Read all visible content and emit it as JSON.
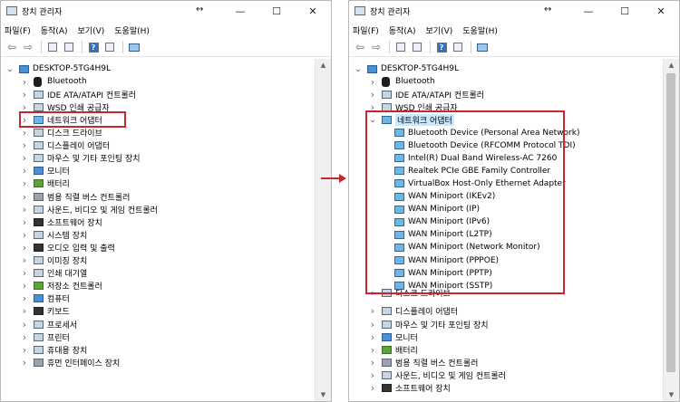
{
  "left_window": {
    "title": "장치 관리자",
    "resize_glyph": "↔",
    "menu": [
      "파일(F)",
      "동작(A)",
      "보기(V)",
      "도움말(H)"
    ],
    "root": "DESKTOP-5TG4H9L",
    "categories": [
      "Bluetooth",
      "IDE ATA/ATAPI 컨트롤러",
      "WSD 인쇄 공급자",
      "네트워크 어댑터",
      "디스크 드라이브",
      "디스플레이 어댑터",
      "마우스 및 기타 포인팅 장치",
      "모니터",
      "배터리",
      "범용 직렬 버스 컨트롤러",
      "사운드, 비디오 및 게임 컨트롤러",
      "소프트웨어 장치",
      "시스템 장치",
      "오디오 입력 및 출력",
      "이미징 장치",
      "인쇄 대기열",
      "저장소 컨트롤러",
      "컴퓨터",
      "키보드",
      "프로세서",
      "프린터",
      "휴대용 장치",
      "휴먼 인터페이스 장치"
    ],
    "highlighted": "네트워크 어댑터"
  },
  "right_window": {
    "title": "장치 관리자",
    "resize_glyph": "↔",
    "menu": [
      "파일(F)",
      "동작(A)",
      "보기(V)",
      "도움말(H)"
    ],
    "root": "DESKTOP-5TG4H9L",
    "categories_before": [
      "Bluetooth",
      "IDE ATA/ATAPI 컨트롤러",
      "WSD 인쇄 공급자"
    ],
    "expanded_category": "네트워크 어댑터",
    "network_adapters": [
      "Bluetooth Device (Personal Area Network)",
      "Bluetooth Device (RFCOMM Protocol TDI)",
      "Intel(R) Dual Band Wireless-AC 7260",
      "Realtek PCIe GBE Family Controller",
      "VirtualBox Host-Only Ethernet Adapter",
      "WAN Miniport (IKEv2)",
      "WAN Miniport (IP)",
      "WAN Miniport (IPv6)",
      "WAN Miniport (L2TP)",
      "WAN Miniport (Network Monitor)",
      "WAN Miniport (PPPOE)",
      "WAN Miniport (PPTP)",
      "WAN Miniport (SSTP)"
    ],
    "categories_after": [
      "디스크 드라이브",
      "디스플레이 어댑터",
      "마우스 및 기타 포인팅 장치",
      "모니터",
      "배터리",
      "범용 직렬 버스 컨트롤러",
      "사운드, 비디오 및 게임 컨트롤러",
      "소프트웨어 장치"
    ]
  },
  "colors": {
    "highlight_border": "#c8262e",
    "selection_bg": "#cce8ff"
  }
}
